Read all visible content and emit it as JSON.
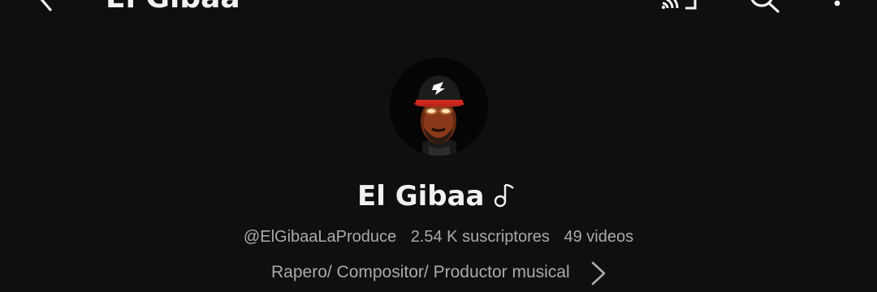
{
  "header": {
    "title": "El Gibaa",
    "icons": [
      "back-arrow-icon",
      "cast-icon",
      "search-icon",
      "more-vert-icon"
    ]
  },
  "channel": {
    "name": "El Gibaa",
    "badge_icon": "music-note-icon",
    "handle": "@ElGibaaLaProduce",
    "subscribers": "2.54 K suscriptores",
    "videos": "49 videos",
    "description": "Rapero/ Compositor/ Productor musical"
  },
  "colors": {
    "background": "#0f0f0f",
    "primary_text": "#f1f1f1",
    "secondary_text": "#aaaaaa"
  }
}
